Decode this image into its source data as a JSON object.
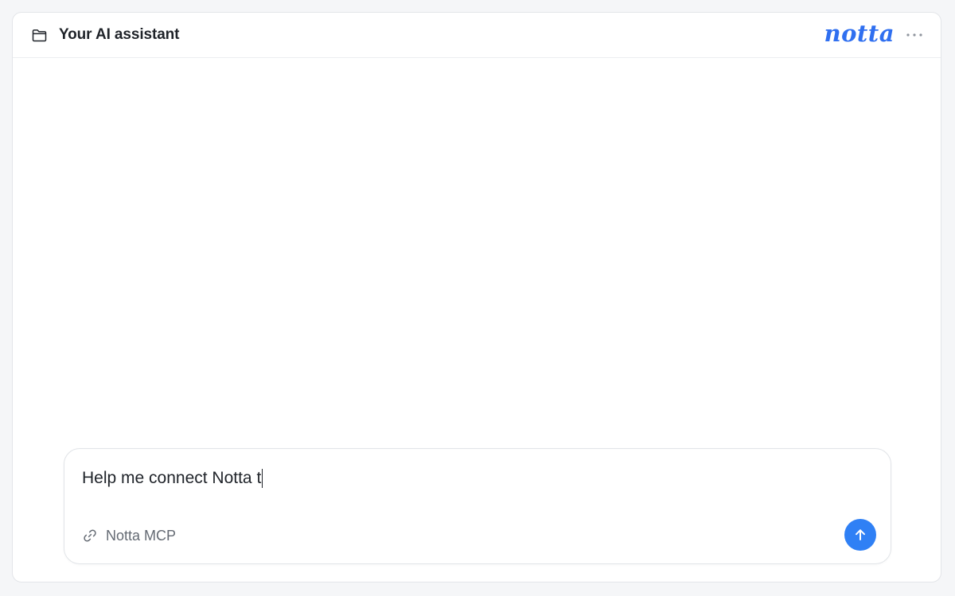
{
  "header": {
    "title": "Your AI assistant",
    "title_icon": "folder-icon",
    "logo_text": "notta",
    "menu_icon": "more-horizontal-icon"
  },
  "composer": {
    "input_value": "Help me connect Notta t",
    "chip_icon": "link-icon",
    "chip_label": "Notta MCP",
    "send_icon": "arrow-up-icon"
  },
  "colors": {
    "brand": "#2f6ff0",
    "send_button": "#2f80f5",
    "muted_text": "#646a73"
  }
}
